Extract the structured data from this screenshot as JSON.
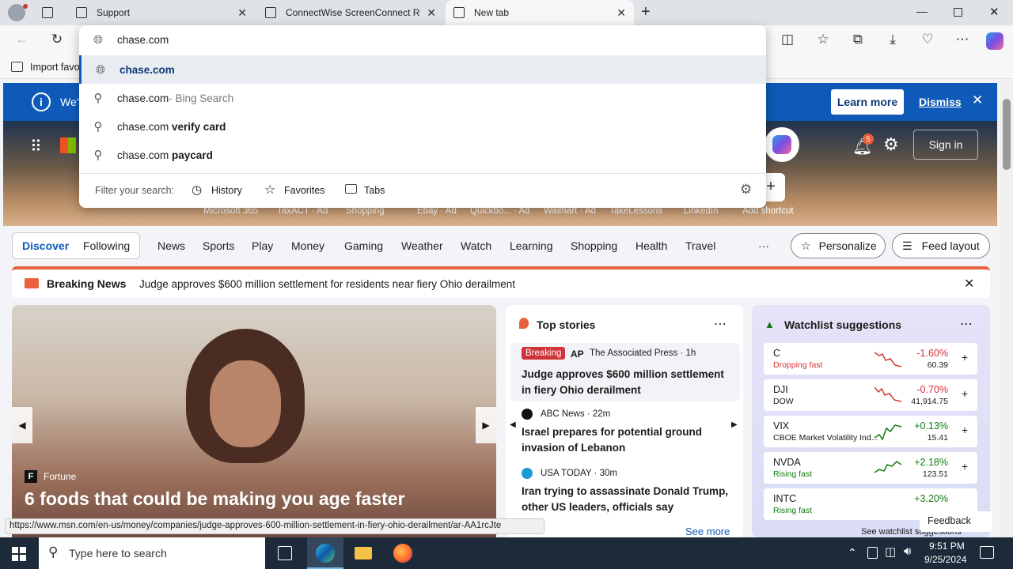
{
  "tabs": [
    {
      "label": "Support"
    },
    {
      "label": "ConnectWise ScreenConnect Re"
    },
    {
      "label": "New tab"
    }
  ],
  "favorites_bar": {
    "import": "Import favo"
  },
  "address_dropdown": {
    "input_value": "chase.com",
    "suggestions": [
      {
        "bold": "chase.com",
        "rest": ""
      },
      {
        "bold": "chase.com",
        "rest": " - Bing Search"
      },
      {
        "prefix": "chase.com ",
        "bold": "verify card"
      },
      {
        "prefix": "chase.com ",
        "bold": "paycard"
      }
    ],
    "filter_label": "Filter your search:",
    "filters": [
      "History",
      "Favorites",
      "Tabs"
    ]
  },
  "banner": {
    "text": "We'",
    "learn_more": "Learn more",
    "dismiss": "Dismiss"
  },
  "hero": {
    "notif_count": "5",
    "sign_in": "Sign in",
    "shortcuts": [
      "Microsoft 365",
      "TaxACT · Ad",
      "Shopping",
      "Ebay · Ad",
      "Quickbo... · Ad",
      "Walmart · Ad",
      "TakeLessons",
      "LinkedIn",
      "Add shortcut"
    ]
  },
  "nav": {
    "discover": "Discover",
    "following": "Following",
    "items": [
      "News",
      "Sports",
      "Play",
      "Money",
      "Gaming",
      "Weather",
      "Watch",
      "Learning",
      "Shopping",
      "Health",
      "Travel"
    ],
    "more": "···",
    "personalize": "Personalize",
    "feed_layout": "Feed layout"
  },
  "breaking": {
    "label": "Breaking News",
    "headline": "Judge approves $600 million settlement for residents near fiery Ohio derailment"
  },
  "main_story": {
    "source": "Fortune",
    "title": "6 foods that could be making you age faster"
  },
  "top_stories": {
    "title": "Top stories",
    "items": [
      {
        "badge": "Breaking",
        "source": "The Associated Press · 1h",
        "headline": "Judge approves $600 million settlement in fiery Ohio derailment"
      },
      {
        "source": "ABC News · 22m",
        "headline": "Israel prepares for potential ground invasion of Lebanon"
      },
      {
        "source": "USA TODAY · 30m",
        "headline": "Iran trying to assassinate Donald Trump, other US leaders, officials say"
      }
    ],
    "see_more": "See more"
  },
  "watchlist": {
    "title": "Watchlist suggestions",
    "items": [
      {
        "sym": "C",
        "sub": "Dropping fast",
        "change": "-1.60%",
        "price": "60.39",
        "up": false
      },
      {
        "sym": "DJI",
        "sub": "DOW",
        "change": "-0.70%",
        "price": "41,914.75",
        "up": false
      },
      {
        "sym": "VIX",
        "sub": "CBOE Market Volatility Ind...",
        "change": "+0.13%",
        "price": "15.41",
        "up": true
      },
      {
        "sym": "NVDA",
        "sub": "Rising fast",
        "change": "+2.18%",
        "price": "123.51",
        "up": true
      },
      {
        "sym": "INTC",
        "sub": "Rising fast",
        "change": "+3.20%",
        "price": "",
        "up": true
      }
    ],
    "see_more": "See watchlist suggestions"
  },
  "feedback": "Feedback",
  "status_url": "https://www.msn.com/en-us/money/companies/judge-approves-600-million-settlement-in-fiery-ohio-derailment/ar-AA1rcJte",
  "taskbar": {
    "search_placeholder": "Type here to search",
    "time": "9:51 PM",
    "date": "9/25/2024"
  },
  "colors": {
    "accent": "#0f5ab8",
    "breaking": "#e8613c",
    "down": "#d13438",
    "up": "#107c10"
  }
}
